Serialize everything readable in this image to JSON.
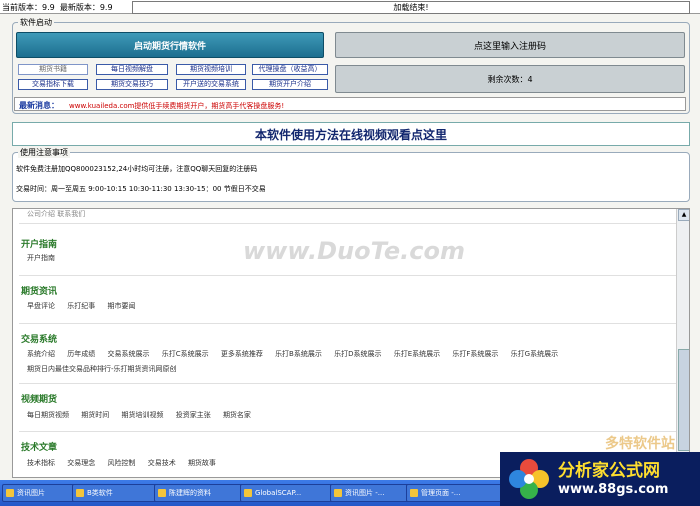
{
  "version_bar": {
    "current_version_label": "当前版本：9.9",
    "latest_version_label": "最新版本：9.9",
    "load_status": "加载结束!"
  },
  "software_start": {
    "group_label": "软件启动",
    "start_button": "启动期货行情软件",
    "register_button": "点这里输入注册码",
    "remaining": "剩余次数：4",
    "links": [
      "期货书籍",
      "每日视频解盘",
      "期货视频培训",
      "代理操盘（收益高）",
      "交易指标下载",
      "期货交易技巧",
      "开户送的交易系统",
      "期货开户介绍"
    ]
  },
  "news": {
    "label": "最新消息：",
    "text": "www.kuaileda.com提供低手续费期货开户，期货高手代客操盘服务!"
  },
  "banner": "本软件使用方法在线视频观看点这里",
  "notice": {
    "group_label": "使用注意事项",
    "line1": "软件免费注册加QQ800023152,24小时均可注册，注意QQ聊天回复的注册码",
    "line2": "交易时间：周一至周五 9:00-10:15  10:30-11:30  13:30-15：00 节假日不交易"
  },
  "web": {
    "top_partial": "公司介绍    联系我们",
    "categories": [
      {
        "title": "开户指南",
        "items": [
          "开户指南"
        ]
      },
      {
        "title": "期货资讯",
        "items": [
          "早盘评论",
          "乐打纪事",
          "期市要闻"
        ]
      },
      {
        "title": "交易系统",
        "items": [
          "系统介绍",
          "历年成绩",
          "交易系统展示",
          "乐打C系统展示",
          "更多系统推荐",
          "乐打B系统展示",
          "乐打D系统展示",
          "乐打E系统展示",
          "乐打F系统展示",
          "乐打G系统展示"
        ],
        "items2": [
          "期货日内最佳交易品种排行-乐打期货资讯网原创"
        ]
      },
      {
        "title": "视频期货",
        "items": [
          "每日期货视频",
          "期货时间",
          "期货培训视频",
          "投资家主张",
          "期货名家"
        ]
      },
      {
        "title": "技术文章",
        "items": [
          "技术指标",
          "交易理念",
          "风险控制",
          "交易技术",
          "期货故事"
        ]
      }
    ]
  },
  "watermark": "www.DuoTe.com",
  "watermark2": "多特软件站",
  "taskbar": {
    "items": [
      "资讯图片",
      "B类软件",
      "陈建辉的资料",
      "GlobalSCAP...",
      "资讯图片 -...",
      "管理页面 -..."
    ]
  },
  "logo": {
    "title": "分析家公式网",
    "url": "www.88gs.com"
  }
}
